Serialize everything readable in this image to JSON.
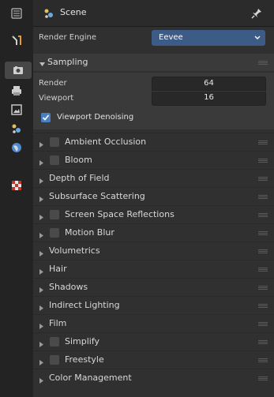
{
  "header": {
    "scene_label": "Scene",
    "scene_icon": "scene-icon",
    "pin_icon": "pin-icon"
  },
  "tabs": [
    {
      "name": "tool-tab",
      "icon": "tool-icon"
    },
    {
      "name": "render-tab",
      "icon": "camera-icon",
      "active": true
    },
    {
      "name": "output-tab",
      "icon": "printer-icon"
    },
    {
      "name": "view-layer-tab",
      "icon": "image-icon"
    },
    {
      "name": "scene-tab",
      "icon": "scene-icon"
    },
    {
      "name": "world-tab",
      "icon": "world-icon"
    },
    {
      "name": "texture-tab",
      "icon": "checker-icon"
    }
  ],
  "render_engine": {
    "label": "Render Engine",
    "value": "Eevee"
  },
  "sampling": {
    "title": "Sampling",
    "render_label": "Render",
    "render_value": "64",
    "viewport_label": "Viewport",
    "viewport_value": "16",
    "denoise_label": "Viewport Denoising",
    "denoise_checked": true
  },
  "sections": [
    {
      "title": "Ambient Occlusion",
      "checkbox": true
    },
    {
      "title": "Bloom",
      "checkbox": true
    },
    {
      "title": "Depth of Field",
      "checkbox": false
    },
    {
      "title": "Subsurface Scattering",
      "checkbox": false
    },
    {
      "title": "Screen Space Reflections",
      "checkbox": true
    },
    {
      "title": "Motion Blur",
      "checkbox": true
    },
    {
      "title": "Volumetrics",
      "checkbox": false
    },
    {
      "title": "Hair",
      "checkbox": false
    },
    {
      "title": "Shadows",
      "checkbox": false
    },
    {
      "title": "Indirect Lighting",
      "checkbox": false
    },
    {
      "title": "Film",
      "checkbox": false
    },
    {
      "title": "Simplify",
      "checkbox": true
    },
    {
      "title": "Freestyle",
      "checkbox": true
    },
    {
      "title": "Color Management",
      "checkbox": false
    }
  ],
  "colors": {
    "accent": "#3c5b87",
    "checkbox_on": "#4a7fc1",
    "panel_bg": "#303030"
  }
}
